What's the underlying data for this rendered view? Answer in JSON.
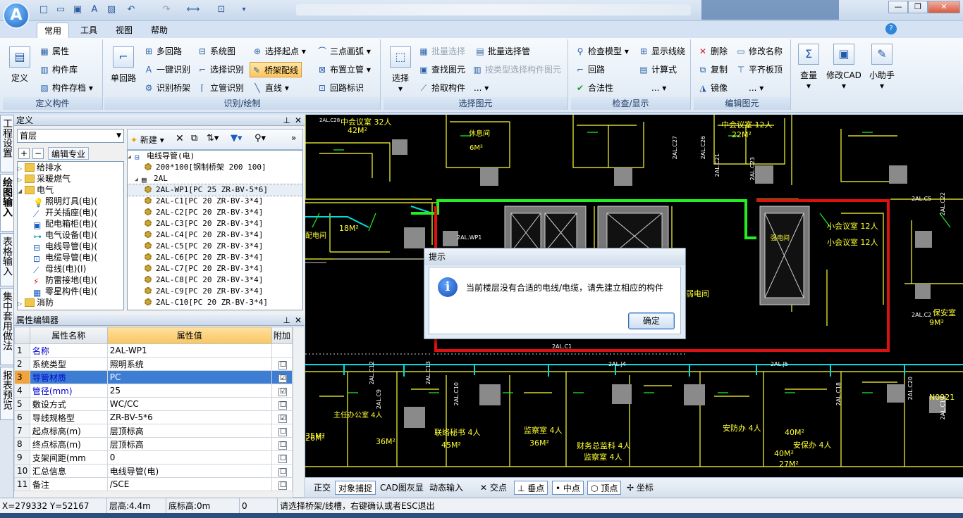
{
  "app": {
    "logo_letter": "A"
  },
  "window": {
    "min": "—",
    "max": "❐",
    "close": "✕"
  },
  "tabs": [
    "常用",
    "工具",
    "视图",
    "帮助"
  ],
  "ribbon": {
    "groups": [
      {
        "label": "定义构件",
        "big": "定义",
        "items": [
          "属性",
          "构件库",
          "构件存档"
        ]
      },
      {
        "label": "识别/绘制",
        "big": "单回路",
        "items": [
          "多回路",
          "系统图",
          "选择起点",
          "三点画弧",
          "一键识别",
          "选择识别",
          "桥架配线",
          "布置立管",
          "识别桥架",
          "立管识别",
          "直线",
          "回路标识"
        ]
      },
      {
        "label": "选择图元",
        "big": "选择",
        "items": [
          "批量选择",
          "批量选择管",
          "查找图元",
          "按类型选择构件图元",
          "拾取构件",
          "..."
        ]
      },
      {
        "label": "检查/显示",
        "items": [
          "检查模型",
          "显示线绕",
          "回路",
          "计算式",
          "合法性",
          "..."
        ]
      },
      {
        "label": "编辑图元",
        "items": [
          "删除",
          "修改名称",
          "复制",
          "平齐板顶",
          "镜像",
          "..."
        ]
      },
      {
        "bigs": [
          "查量",
          "修改CAD",
          "小助手"
        ]
      }
    ]
  },
  "vtabs": [
    "工程设置",
    "绘图输入",
    "表格输入",
    "集中套用做法",
    "报表预览"
  ],
  "definition_panel": {
    "title": "定义",
    "floor": "首层",
    "edit_major": "编辑专业",
    "tree": [
      "给排水",
      "采暖燃气",
      "电气",
      "照明灯具(电)(",
      "开关插座(电)(",
      "配电箱柜(电)(",
      "电气设备(电)(",
      "电线导管(电)(",
      "电缆导管(电)(",
      "母线(电)(I)",
      "防雷接地(电)(",
      "零星构件(电)(",
      "消防"
    ]
  },
  "component_panel": {
    "new_label": "新建",
    "tree": [
      "电线导管(电)",
      "200*100[钢制桥架 200 100]",
      "2AL",
      "2AL-WP1[PC 25 ZR-BV-5*6]",
      "2AL-C1[PC 20 ZR-BV-3*4]",
      "2AL-C2[PC 20 ZR-BV-3*4]",
      "2AL-C3[PC 20 ZR-BV-3*4]",
      "2AL-C4[PC 20 ZR-BV-3*4]",
      "2AL-C5[PC 20 ZR-BV-3*4]",
      "2AL-C6[PC 20 ZR-BV-3*4]",
      "2AL-C7[PC 20 ZR-BV-3*4]",
      "2AL-C8[PC 20 ZR-BV-3*4]",
      "2AL-C9[PC 20 ZR-BV-3*4]",
      "2AL-C10[PC 20 ZR-BV-3*4]"
    ]
  },
  "property_panel": {
    "title": "属性编辑器",
    "headers": [
      "属性名称",
      "属性值",
      "附加"
    ],
    "rows": [
      {
        "n": "1",
        "name": "名称",
        "value": "2AL-WP1",
        "chk": "",
        "blue": true
      },
      {
        "n": "2",
        "name": "系统类型",
        "value": "照明系统",
        "chk": "☐"
      },
      {
        "n": "3",
        "name": "导管材质",
        "value": "PC",
        "chk": "☑",
        "blue": true,
        "hl": true
      },
      {
        "n": "4",
        "name": "管径(mm)",
        "value": "25",
        "chk": "☑",
        "blue": true
      },
      {
        "n": "5",
        "name": "敷设方式",
        "value": "WC/CC",
        "chk": "☐"
      },
      {
        "n": "6",
        "name": "导线规格型",
        "value": "ZR-BV-5*6",
        "chk": "☑"
      },
      {
        "n": "7",
        "name": "起点标高(m)",
        "value": "层顶标高",
        "chk": "☐"
      },
      {
        "n": "8",
        "name": "终点标高(m)",
        "value": "层顶标高",
        "chk": "☐"
      },
      {
        "n": "9",
        "name": "支架间距(mm",
        "value": "0",
        "chk": "☐"
      },
      {
        "n": "10",
        "name": "汇总信息",
        "value": "电线导管(电)",
        "chk": "☐"
      },
      {
        "n": "11",
        "name": "备注",
        "value": "/SCE",
        "chk": "☐"
      }
    ]
  },
  "cad_labels": [
    "中会议室 32人",
    "42M²",
    "休息间",
    "6M²",
    "中会议室 12人",
    "22M²",
    "小会议室 12人",
    "小会议室 12人",
    "强电间",
    "弱电间",
    "2AL.WP1",
    "2AL.C1",
    "2AL.C2",
    "2AL.C5",
    "配电间",
    "18M²",
    "保安室",
    "9M²",
    "主任办公室 4人",
    "36M²",
    "35M²",
    "联络秘书 4人",
    "45M²",
    "监察室 4人",
    "36M²",
    "财务总监科 4人",
    "监察室 4人",
    "安防办 4人",
    "40M²",
    "安保办 4人",
    "40M²",
    "27M²",
    "26M²",
    "N0921",
    "2AL.C28",
    "2AL.C27",
    "2AL.C26",
    "2AL.C21",
    "2AL.C12",
    "2AL.C13",
    "2AL.J4",
    "2AL.J5",
    "2AL.C17",
    "2AL.C18",
    "2AL.C20",
    "2AL.C22",
    "2AL.C23",
    "2AL.C9",
    "2AL.C10"
  ],
  "dialog": {
    "title": "提示",
    "message": "当前楼层没有合适的电线/电缆，请先建立相应的构件",
    "ok": "确定"
  },
  "snapbar": [
    "正交",
    "对象捕捉",
    "CAD图灰显",
    "动态输入",
    "交点",
    "垂点",
    "中点",
    "顶点",
    "坐标"
  ],
  "status": {
    "coords": "X=279332 Y=52167",
    "floor_h": "层高:4.4m",
    "base_h": "底标高:0m",
    "zero": "0",
    "hint": "请选择桥架/线槽，右键确认或者ESC退出"
  },
  "colors": {
    "cad_bg": "#000000",
    "cad_yellow": "#ffff33",
    "cad_green": "#22ee22",
    "cad_cyan": "#00dddd",
    "cad_red": "#dd1111",
    "hl_row": "#3d7ed4"
  }
}
